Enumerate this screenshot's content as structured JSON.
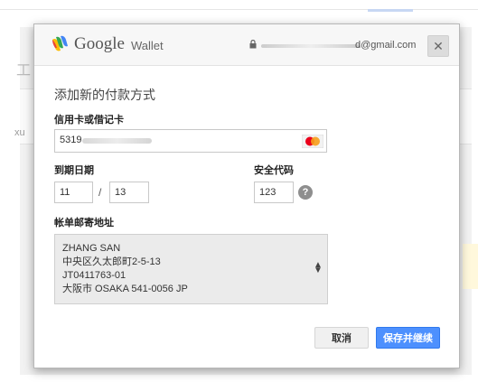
{
  "background": {
    "partial_text_1": "工",
    "partial_text_2": "xu"
  },
  "header": {
    "brand_primary": "Google",
    "brand_secondary": "Wallet",
    "account_visible": "d@gmail.com",
    "close_label": "✕"
  },
  "form": {
    "title": "添加新的付款方式",
    "card_label": "信用卡或借记卡",
    "card_value_visible": "5319",
    "card_brand_icon": "mastercard-icon",
    "expiry_label": "到期日期",
    "expiry_month": "11",
    "expiry_separator": "/",
    "expiry_year": "13",
    "cvc_label": "安全代码",
    "cvc_value": "123",
    "cvc_help": "?",
    "address_label": "帐单邮寄地址",
    "address_lines": [
      "ZHANG SAN",
      "中央区久太郎町2-5-13",
      "JT0411763-01",
      "大阪市 OSAKA 541-0056 JP"
    ]
  },
  "buttons": {
    "cancel": "取消",
    "save": "保存并继续"
  },
  "colors": {
    "primary_button": "#4d90fe",
    "wallet_logo": [
      "#4285f4",
      "#34a853",
      "#fbbc05",
      "#ea4335"
    ]
  }
}
